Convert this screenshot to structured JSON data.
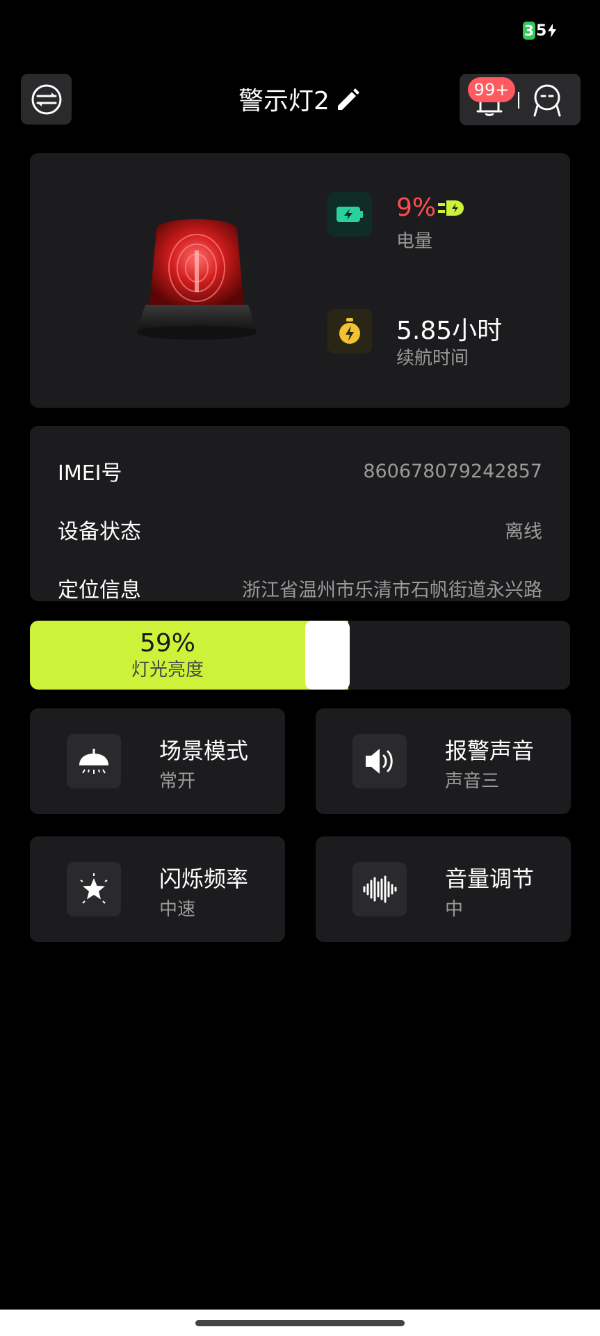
{
  "status_bar": {
    "battery_level": "35",
    "battery_first_digit": "3",
    "battery_rest": "5",
    "charging": true
  },
  "header": {
    "title": "警示灯2",
    "notification_badge": "99+"
  },
  "device": {
    "battery_percent": "9%",
    "battery_label": "电量",
    "runtime_value": "5.85小时",
    "runtime_label": "续航时间",
    "battery_color": "#ff4d4f"
  },
  "info": {
    "imei_label": "IMEI号",
    "imei_value": "860678079242857",
    "status_label": "设备状态",
    "status_value": "离线",
    "location_label": "定位信息",
    "location_value": "浙江省温州市乐清市石帆街道永兴路"
  },
  "brightness": {
    "value_text": "59%",
    "value": 0.59,
    "label": "灯光亮度",
    "accent": "#cdf23a"
  },
  "tiles": [
    {
      "title": "场景模式",
      "sub": "常开",
      "icon": "lamp-icon"
    },
    {
      "title": "报警声音",
      "sub": "声音三",
      "icon": "speaker-icon"
    },
    {
      "title": "闪烁频率",
      "sub": "中速",
      "icon": "starburst-icon"
    },
    {
      "title": "音量调节",
      "sub": "中",
      "icon": "soundwave-icon"
    }
  ]
}
